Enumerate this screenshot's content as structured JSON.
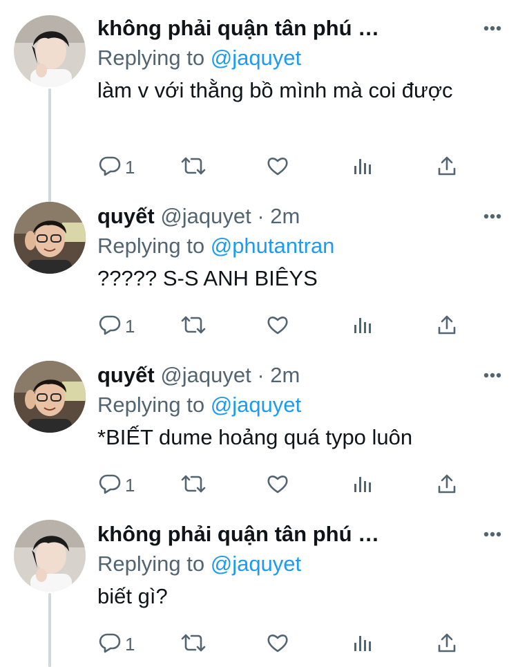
{
  "tweets": [
    {
      "name": "không phải quận tân phú …",
      "handle": "",
      "time": "",
      "replying_prefix": "Replying to ",
      "replying_to": "@jaquyet",
      "text": "làm v với thằng bồ mình mà coi được",
      "reply_count": "1",
      "avatar": "avatar-boy-dark-hair"
    },
    {
      "name": "quyết",
      "handle": "@jaquyet",
      "time": "· 2m",
      "replying_prefix": "Replying to ",
      "replying_to": "@phutantran",
      "text": "????? S-S ANH BIÊYS",
      "reply_count": "1",
      "avatar": "avatar-boy-glasses"
    },
    {
      "name": "quyết",
      "handle": "@jaquyet",
      "time": "· 2m",
      "replying_prefix": "Replying to ",
      "replying_to": "@jaquyet",
      "text": "*BIẾT dume hoảng quá typo luôn",
      "reply_count": "1",
      "avatar": "avatar-boy-glasses"
    },
    {
      "name": "không phải quận tân phú …",
      "handle": "",
      "time": "",
      "replying_prefix": "Replying to ",
      "replying_to": "@jaquyet",
      "text": "biết gì?",
      "reply_count": "1",
      "avatar": "avatar-boy-dark-hair"
    }
  ],
  "icons": {
    "more": "more-icon",
    "reply": "reply-icon",
    "retweet": "retweet-icon",
    "like": "like-icon",
    "views": "views-icon",
    "share": "share-icon"
  },
  "colors": {
    "text": "#0f1419",
    "secondary": "#536471",
    "link": "#1d9bf0",
    "thread_line": "#cfd9de"
  }
}
